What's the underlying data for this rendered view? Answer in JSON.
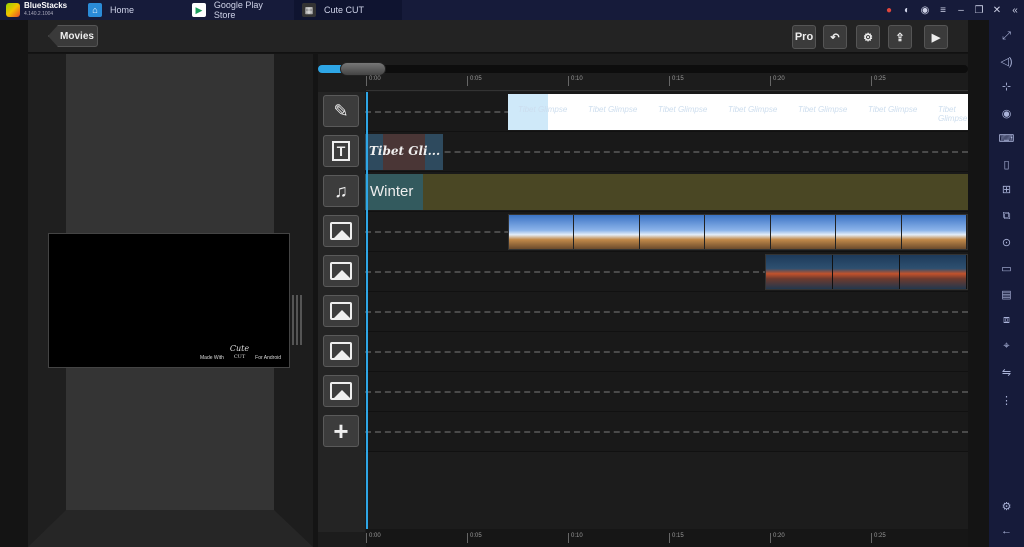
{
  "titlebar": {
    "brand_name": "BlueStacks",
    "brand_version": "4.140.2.1004",
    "tabs": [
      {
        "label": "Home"
      },
      {
        "label": "Google Play Store"
      },
      {
        "label": "Cute CUT"
      }
    ]
  },
  "app": {
    "back_label": "Movies",
    "pro_label": "Pro"
  },
  "preview": {
    "watermark_made_with": "Made With",
    "watermark_cute": "Cute",
    "watermark_cut": "CUT",
    "watermark_platform": "For Android"
  },
  "timeline": {
    "ticks": [
      "0:00",
      "0:05",
      "0:10",
      "0:15",
      "0:20",
      "0:25"
    ],
    "tracks": {
      "title_ghost_text": "Tibet Glimpse",
      "text_clip": "Tibet Gli...",
      "music_clip": "Winter"
    }
  },
  "colors": {
    "accent": "#2ea6e6",
    "titlebar_bg": "#161b3a"
  }
}
